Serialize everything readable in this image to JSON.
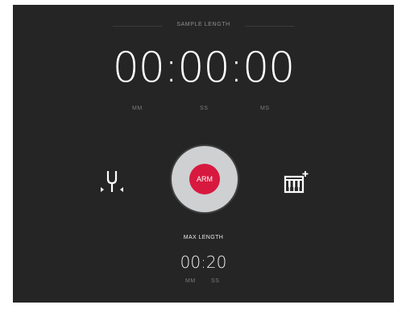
{
  "sample": {
    "heading": "SAMPLE LENGTH",
    "time": "00:00:00",
    "units": {
      "mm": "MM",
      "ss": "SS",
      "ms": "MS"
    }
  },
  "controls": {
    "tuner_icon": "tuning-fork-icon",
    "arm_label": "ARM",
    "keyboard_icon": "piano-keys-add-icon"
  },
  "max_length": {
    "label": "MAX LENGTH",
    "time": "00:20",
    "units": {
      "mm": "MM",
      "ss": "SS"
    }
  },
  "colors": {
    "background": "#252525",
    "arm_red": "#d8193f",
    "arm_ring": "#cfd0d2"
  }
}
